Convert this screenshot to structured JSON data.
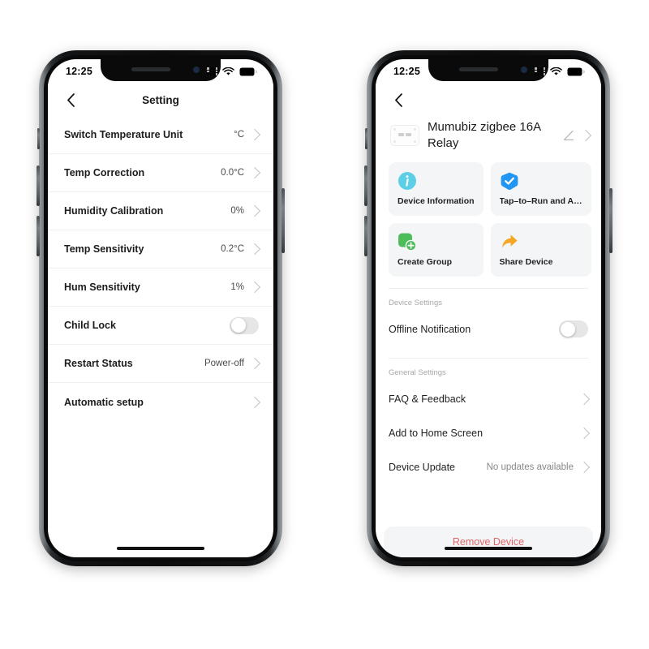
{
  "page": {
    "background": "#ffffff"
  },
  "phones": {
    "left": {
      "statusbar": {
        "time": "12:25",
        "signal_icon": "signal-dots-icon",
        "wifi_icon": "wifi-icon",
        "battery_icon": "battery-icon"
      },
      "nav": {
        "back_icon": "back-chevron-icon",
        "title": "Setting"
      },
      "rows": [
        {
          "label": "Switch Temperature Unit",
          "value": "°C",
          "type": "chevron"
        },
        {
          "label": "Temp Correction",
          "value": "0.0°C",
          "type": "chevron"
        },
        {
          "label": "Humidity Calibration",
          "value": "0%",
          "type": "chevron"
        },
        {
          "label": "Temp Sensitivity",
          "value": "0.2°C",
          "type": "chevron"
        },
        {
          "label": "Hum Sensitivity",
          "value": "1%",
          "type": "chevron"
        },
        {
          "label": "Child Lock",
          "value": "",
          "type": "toggle",
          "toggle_on": false
        },
        {
          "label": "Restart Status",
          "value": "Power-off",
          "type": "chevron"
        },
        {
          "label": "Automatic setup",
          "value": "",
          "type": "chevron"
        }
      ]
    },
    "right": {
      "statusbar": {
        "time": "12:25",
        "signal_icon": "signal-dots-icon",
        "wifi_icon": "wifi-icon",
        "battery_icon": "battery-icon"
      },
      "nav": {
        "back_icon": "back-chevron-icon",
        "title": ""
      },
      "device": {
        "thumb_icon": "relay-module-icon",
        "name": "Mumubiz zigbee 16A Relay",
        "edit_icon": "pencil-icon",
        "chevron_icon": "chevron-right-icon"
      },
      "cards": [
        {
          "label": "Device Information",
          "icon": "info-circle-icon",
          "color": "#5ccfe6"
        },
        {
          "label": "Tap–to–Run and A…",
          "icon": "check-shield-icon",
          "color": "#2196f3"
        },
        {
          "label": "Create Group",
          "icon": "create-group-icon",
          "color": "#4cbd5a"
        },
        {
          "label": "Share Device",
          "icon": "share-arrow-icon",
          "color": "#f5a623"
        }
      ],
      "sections": [
        {
          "title": "Device Settings",
          "rows": [
            {
              "label": "Offline Notification",
              "value": "",
              "type": "toggle",
              "toggle_on": false
            }
          ]
        },
        {
          "title": "General Settings",
          "rows": [
            {
              "label": "FAQ & Feedback",
              "value": "",
              "type": "chevron"
            },
            {
              "label": "Add to Home Screen",
              "value": "",
              "type": "chevron"
            },
            {
              "label": "Device Update",
              "value": "No updates available",
              "type": "chevron"
            }
          ]
        }
      ],
      "remove": {
        "label": "Remove Device",
        "color": "#e06666"
      }
    }
  }
}
